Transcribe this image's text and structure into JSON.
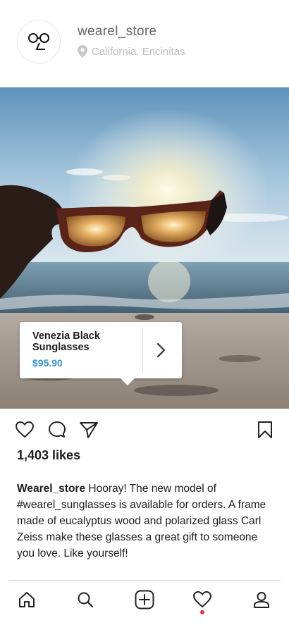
{
  "header": {
    "username": "wearel_store",
    "location": "California, Encinitas"
  },
  "product_tag": {
    "name": "Venezia Black Sunglasses",
    "price": "$95.90"
  },
  "post": {
    "likes": "1,403 likes",
    "caption_user": "Wearel_store",
    "caption_text": " Hooray! The new model of #wearel_sunglasses is available for orders. A frame made of eucalyptus wood and polarized glass Carl Zeiss make these glasses a great gift to someone you love. Like yourself!"
  },
  "icons": {
    "avatar": "glasses-logo-icon",
    "location": "location-pin-icon",
    "like": "heart-icon",
    "comment": "comment-icon",
    "share": "send-icon",
    "save": "bookmark-icon",
    "tag_open": "chevron-right-icon",
    "nav": [
      "home-icon",
      "search-icon",
      "add-icon",
      "activity-heart-icon",
      "profile-icon"
    ]
  },
  "colors": {
    "price": "#3a8ed8",
    "notification_dot": "#e8344a",
    "muted_text": "#bdbdbd"
  }
}
